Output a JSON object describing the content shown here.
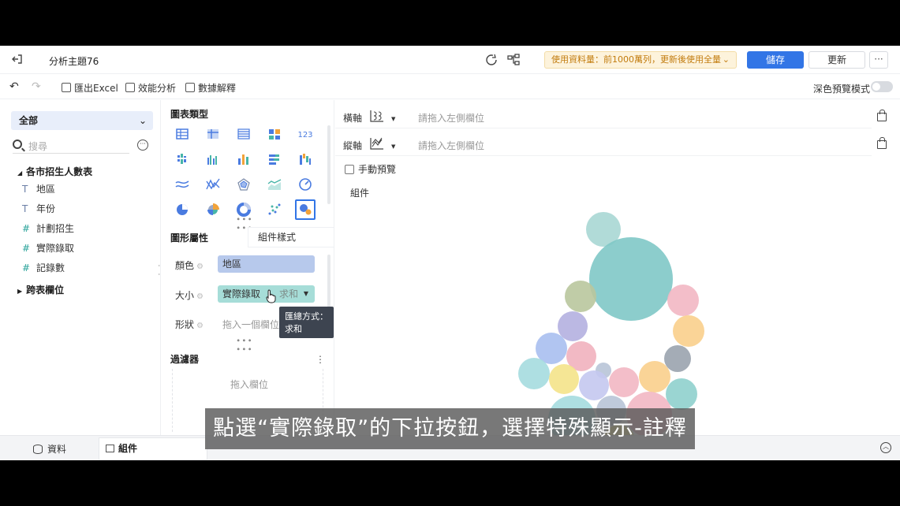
{
  "header": {
    "title": "分析主題76",
    "notice": "使用資料量：前1000萬列，更新後使用全量",
    "save_label": "儲存",
    "update_label": "更新",
    "more_label": "···"
  },
  "toolbar": {
    "export_label": "匯出Excel",
    "perf_label": "效能分析",
    "explain_label": "數據解釋",
    "dark_mode_label": "深色預覽模式"
  },
  "left": {
    "dataset": "全部",
    "search_placeholder": "搜尋",
    "group1": "各市招生人數表",
    "fields": [
      {
        "type": "T",
        "name": "地區"
      },
      {
        "type": "T",
        "name": "年份"
      },
      {
        "type": "#",
        "name": "計劃招生"
      },
      {
        "type": "#",
        "name": "實際錄取"
      },
      {
        "type": "#",
        "name": "記錄數"
      }
    ],
    "group2": "跨表欄位"
  },
  "mid": {
    "chart_types_title": "圖表類型",
    "shape_attr_title": "圖形屬性",
    "style_tab": "組件樣式",
    "color_label": "顏色",
    "color_field": "地區",
    "size_label": "大小",
    "size_field": "實際錄取",
    "size_agg": "求和",
    "shape_label": "形狀",
    "shape_placeholder": "拖入一個欄位",
    "tooltip": "匯總方式：求和",
    "filter_title": "過濾器",
    "filter_placeholder": "拖入欄位",
    "chart_type_icons": [
      "table-icon",
      "cross-table-icon",
      "detail-table-icon",
      "combo-icon",
      "kpi-icon",
      "grouped-bar-icon",
      "bar-icon",
      "column-icon",
      "stacked-bar-icon",
      "waterfall-icon",
      "area-icon",
      "line-icon",
      "radar-icon",
      "area-line-icon",
      "gauge-icon",
      "pie-icon",
      "rose-icon",
      "donut-icon",
      "scatter-icon",
      "bubble-icon"
    ]
  },
  "canvas": {
    "x_axis_label": "橫軸",
    "y_axis_label": "縱軸",
    "x_placeholder": "請拖入左側欄位",
    "y_placeholder": "請拖入左側欄位",
    "manual_preview": "手動預覽",
    "component_title": "組件",
    "bubble_colors": [
      "#7fc8c6",
      "#a9d7d4",
      "#b9c79d",
      "#f2b7c3",
      "#b4b0e0",
      "#f9cf8c",
      "#a9bfef",
      "#f1b1be",
      "#9aa3ae",
      "#a5dcdf",
      "#8fd0cd",
      "#c4c8f0",
      "#f4e38a",
      "#b8c4d7"
    ]
  },
  "bottom": {
    "data_tab": "資料",
    "component_tab": "組件"
  },
  "subtitle": "點選“實際錄取”的下拉按鈕，選擇特殊顯示-註釋"
}
